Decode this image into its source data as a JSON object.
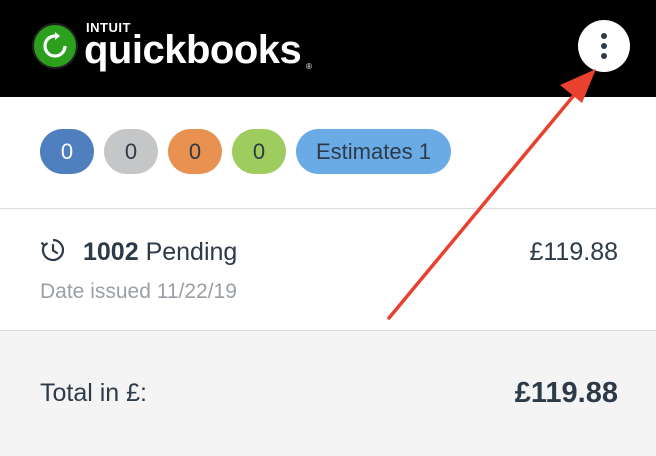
{
  "header": {
    "logo_small": "INTUIT",
    "logo_word": "quickbooks",
    "logo_reg": "®",
    "logo_icon": "quickbooks-logo-icon",
    "menu_icon": "more-vertical-icon"
  },
  "status_chips": [
    {
      "label": "0",
      "color": "#4f7fbf"
    },
    {
      "label": "0",
      "color": "#c5c6c8"
    },
    {
      "label": "0",
      "color": "#e89150"
    },
    {
      "label": "0",
      "color": "#9fcc5e"
    },
    {
      "label": "Estimates 1",
      "color": "#6aabe6"
    }
  ],
  "estimate": {
    "icon": "clock-icon",
    "number": "1002",
    "status": "Pending",
    "date_issued": "Date issued 11/22/19",
    "amount": "£119.88"
  },
  "total": {
    "label": "Total in £:",
    "amount": "£119.88"
  },
  "annotation": {
    "color": "#e8412e"
  }
}
